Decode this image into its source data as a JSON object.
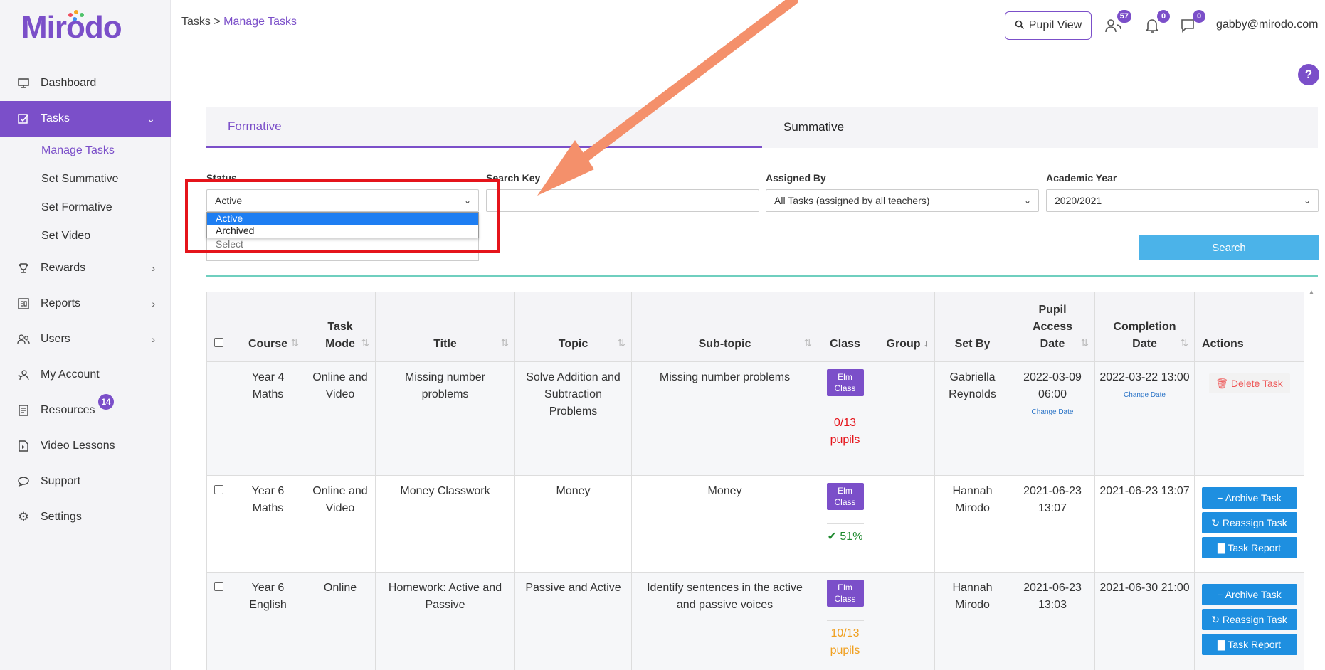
{
  "brand": {
    "logo_text": "Mirodo"
  },
  "sidebar": {
    "items": [
      {
        "label": "Dashboard",
        "icon": "monitor-icon"
      },
      {
        "label": "Tasks",
        "icon": "checklist-icon"
      },
      {
        "label": "Rewards",
        "icon": "trophy-icon"
      },
      {
        "label": "Reports",
        "icon": "report-icon"
      },
      {
        "label": "Users",
        "icon": "users-icon"
      },
      {
        "label": "My Account",
        "icon": "account-icon"
      },
      {
        "label": "Resources",
        "icon": "book-icon",
        "badge": "14"
      },
      {
        "label": "Video Lessons",
        "icon": "video-icon"
      },
      {
        "label": "Support",
        "icon": "chat-icon"
      },
      {
        "label": "Settings",
        "icon": "gear-icon"
      }
    ],
    "tasks_sub": [
      "Manage Tasks",
      "Set Summative",
      "Set Formative",
      "Set Video"
    ]
  },
  "header": {
    "breadcrumb_root": "Tasks",
    "breadcrumb_sep": ">",
    "breadcrumb_current": "Manage Tasks",
    "pupil_view_label": "Pupil View",
    "users_count": "57",
    "notifications_count": "0",
    "messages_count": "0",
    "user_email": "gabby@mirodo.com",
    "help_label": "?"
  },
  "tabs": {
    "formative": "Formative",
    "summative": "Summative"
  },
  "filters": {
    "status_label": "Status",
    "status_value": "Active",
    "status_options": [
      "Active",
      "Archived"
    ],
    "hidden_select_value": "Select",
    "search_keyword_label": "Search Key",
    "search_keyword_value": "",
    "assigned_by_label": "Assigned By",
    "assigned_by_value": "All Tasks (assigned by all teachers)",
    "academic_year_label": "Academic Year",
    "academic_year_value": "2020/2021",
    "search_button": "Search"
  },
  "table": {
    "headers": [
      "Course",
      "Task Mode",
      "Title",
      "Topic",
      "Sub-topic",
      "Class",
      "Group",
      "Set By",
      "Pupil Access Date",
      "Completion Date",
      "Actions"
    ],
    "rows": [
      {
        "course": "Year 4 Maths",
        "mode": "Online and Video",
        "title": "Missing number problems",
        "topic": "Solve Addition and Subtraction Problems",
        "subtopic": "Missing number problems",
        "class": "Elm Class",
        "pupils": "0/13 pupils",
        "group": "",
        "set_by": "Gabriella Reynolds",
        "access": "2022-03-09 06:00",
        "completion": "2022-03-22 13:00",
        "change_date": "Change Date",
        "delete": "Delete Task"
      },
      {
        "course": "Year 6 Maths",
        "mode": "Online and Video",
        "title": "Money Classwork",
        "topic": "Money",
        "subtopic": "Money",
        "class": "Elm Class",
        "pupils": "51%",
        "group": "",
        "set_by": "Hannah Mirodo",
        "access": "2021-06-23 13:07",
        "completion": "2021-06-23 13:07",
        "archive": "Archive Task",
        "reassign": "Reassign Task",
        "report": "Task Report"
      },
      {
        "course": "Year 6 English",
        "mode": "Online",
        "title": "Homework: Active and Passive",
        "topic": "Passive and Active",
        "subtopic": "Identify sentences in the active and passive voices",
        "class": "Elm Class",
        "pupils": "10/13 pupils",
        "group": "",
        "set_by": "Hannah Mirodo",
        "access": "2021-06-23 13:03",
        "completion": "2021-06-30 21:00",
        "archive": "Archive Task",
        "reassign": "Reassign Task",
        "report": "Task Report"
      }
    ]
  },
  "colors": {
    "brand": "#7b4fc9",
    "annotation_box": "#e5141b",
    "annotation_arrow": "#f4906b",
    "search_button": "#4bb3e9",
    "action_button": "#1e8fe0"
  }
}
